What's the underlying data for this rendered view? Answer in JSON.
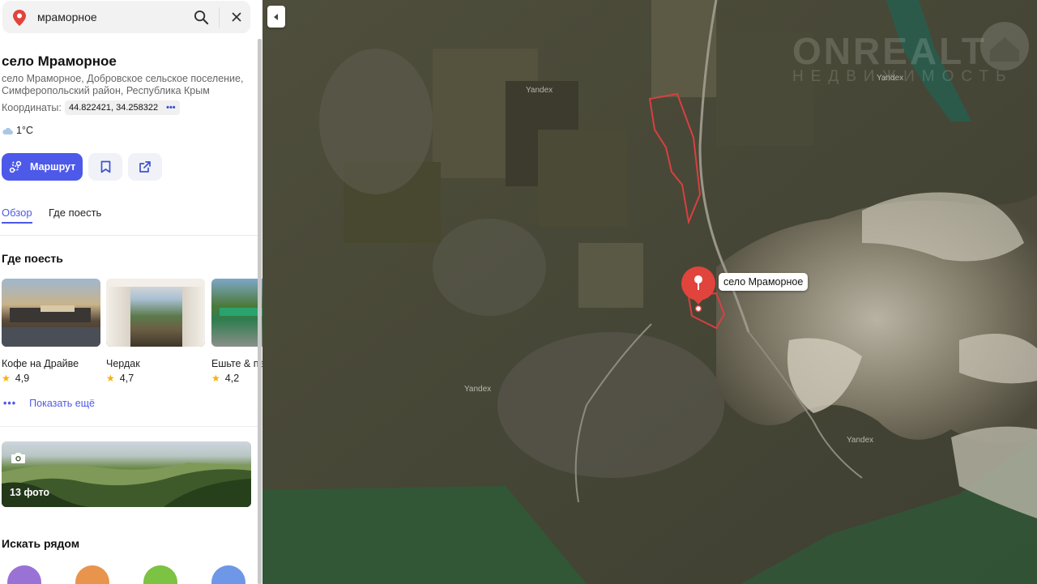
{
  "search": {
    "query": "мраморное"
  },
  "place": {
    "title": "село Мраморное",
    "address": "село Мраморное, Добровское сельское поселение, Симферопольский район, Республика Крым",
    "coords_label": "Координаты:",
    "coords_value": "44.822421, 34.258322",
    "weather": "1°C"
  },
  "actions": {
    "route_label": "Маршрут"
  },
  "tabs": [
    {
      "label": "Обзор",
      "active": true
    },
    {
      "label": "Где поесть",
      "active": false
    }
  ],
  "food": {
    "title": "Где поесть",
    "items": [
      {
        "name": "Кофе на Драйве",
        "rating": "4,9"
      },
      {
        "name": "Чердак",
        "rating": "4,7"
      },
      {
        "name": "Ешьте & пейте",
        "rating": "4,2"
      }
    ],
    "show_more": "Показать ещё"
  },
  "photos": {
    "count_label": "13 фото"
  },
  "nearby": {
    "title": "Искать рядом",
    "categories": [
      {
        "icon": "hotel-icon",
        "color": "#9a72d6"
      },
      {
        "icon": "restaurant-icon",
        "color": "#e8944c"
      },
      {
        "icon": "pharmacy-icon",
        "color": "#7cc243"
      },
      {
        "icon": "shopping-icon",
        "color": "#6f97e8"
      }
    ]
  },
  "map": {
    "marker_label": "село Мраморное",
    "watermark": "ONREALT",
    "watermark_sub": "НЕДВИЖИМОСТЬ",
    "provider": "Yandex"
  },
  "colors": {
    "accent": "#4d59e8",
    "marker": "#e0443c",
    "boundary": "#d84040"
  }
}
